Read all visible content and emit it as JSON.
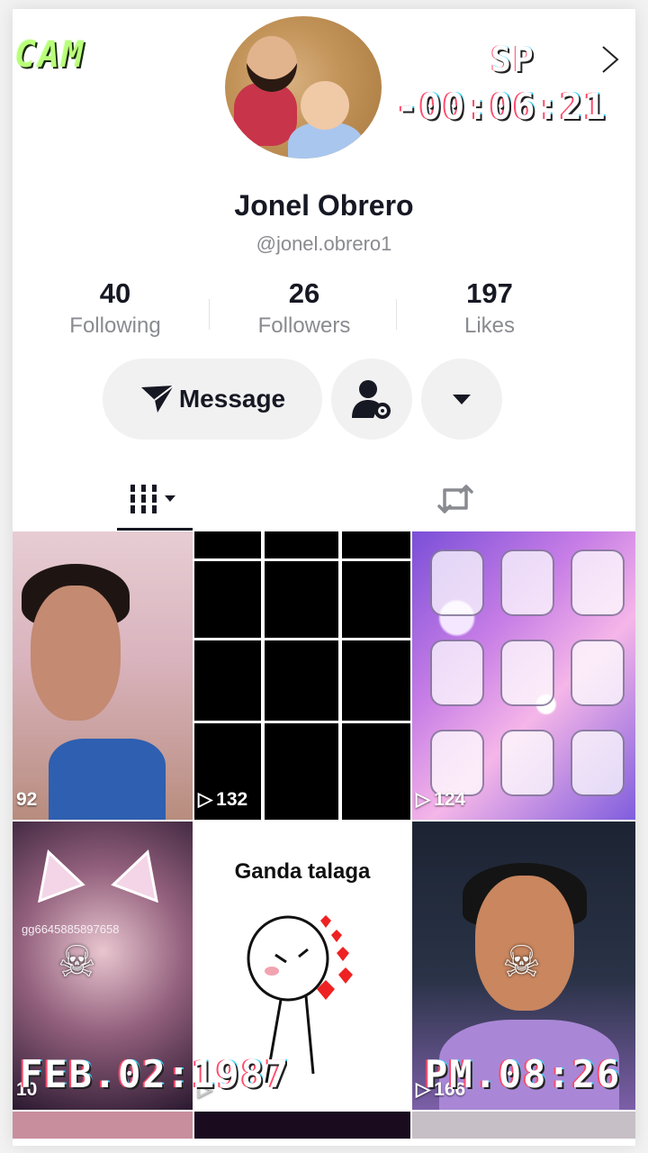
{
  "overlay": {
    "cam": "CAM",
    "sp": "SP",
    "timer": "-00:06:21",
    "date": "FEB.02:1987",
    "clock": "PM.08:26"
  },
  "profile": {
    "name": "Jonel Obrero",
    "handle": "@jonel.obrero1",
    "avatar_icon": "profile-avatar"
  },
  "stats": [
    {
      "value": "40",
      "label": "Following"
    },
    {
      "value": "26",
      "label": "Followers"
    },
    {
      "value": "197",
      "label": "Likes"
    }
  ],
  "actions": {
    "message_label": "Message",
    "message_icon": "send-icon",
    "friend_icon": "add-friend-icon",
    "more_icon": "dropdown-icon"
  },
  "tabs": [
    {
      "name": "videos",
      "icon": "grid-icon",
      "active": true
    },
    {
      "name": "reposts",
      "icon": "repost-icon",
      "active": false
    }
  ],
  "videos": [
    {
      "views": "92",
      "play_icon": false
    },
    {
      "views": "132",
      "play_icon": true
    },
    {
      "views": "124",
      "play_icon": true
    },
    {
      "views": "10",
      "overlay_text": "gg6645885897658",
      "play_icon": false
    },
    {
      "views": "",
      "caption": "Ganda talaga",
      "play_icon": true
    },
    {
      "views": "166",
      "play_icon": true
    }
  ],
  "colors": {
    "vhs_green": "#b9ff7a",
    "text_primary": "#161823",
    "text_secondary": "#8a8b91",
    "button_bg": "#f1f1f2"
  }
}
